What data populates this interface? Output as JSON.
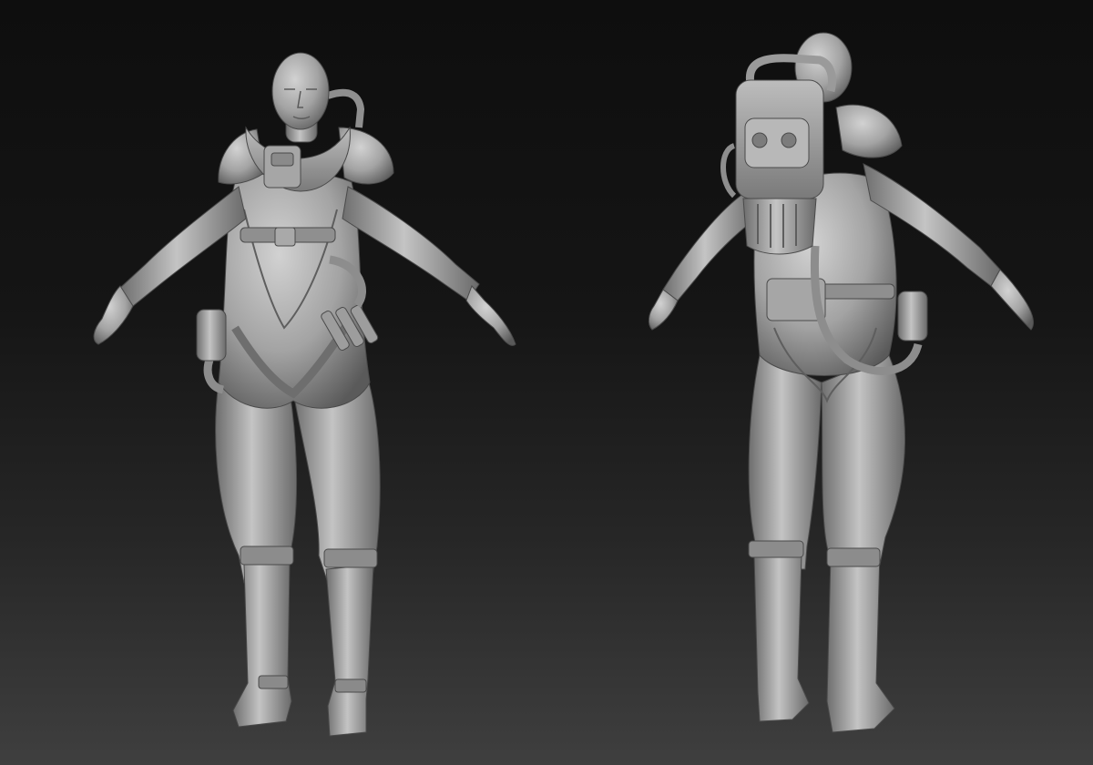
{
  "scene": {
    "subject": "sculpt-turnaround",
    "views": [
      {
        "id": "front",
        "orientation": "front"
      },
      {
        "id": "back",
        "orientation": "back"
      }
    ],
    "colors": {
      "background_top": "#0e0e0e",
      "background_bottom": "#3f3f3f",
      "clay_light": "#c8c8c8",
      "clay_mid": "#9a9a9a",
      "clay_dark": "#5c5c5c"
    }
  }
}
